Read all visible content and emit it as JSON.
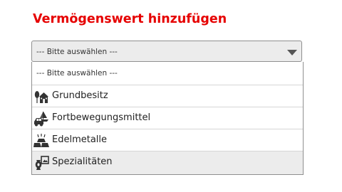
{
  "heading": "Vermögenswert hinzufügen",
  "select": {
    "selected_label": "--- Bitte auswählen ---"
  },
  "options": [
    {
      "label": "--- Bitte auswählen ---"
    },
    {
      "label": "Grundbesitz",
      "icon": "house-tree-icon"
    },
    {
      "label": "Fortbewegungsmittel",
      "icon": "car-boat-icon"
    },
    {
      "label": "Edelmetalle",
      "icon": "gold-bars-icon"
    },
    {
      "label": "Spezialitäten",
      "icon": "vase-painting-icon"
    }
  ],
  "colors": {
    "accent": "#e60000",
    "field_bg": "#ececec",
    "border": "#8f8f8f",
    "highlight": "#ececec"
  }
}
